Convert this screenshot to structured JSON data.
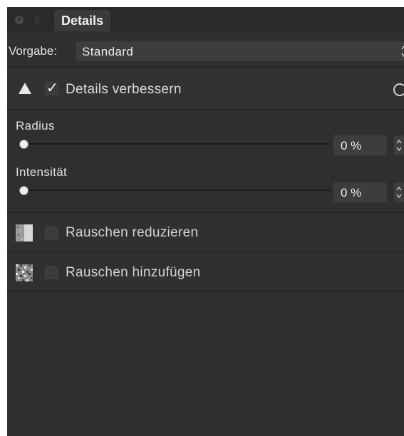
{
  "panel": {
    "tab_title": "Details",
    "close_icon": "close-icon"
  },
  "preset": {
    "label": "Vorgabe:",
    "value": "Standard"
  },
  "section": {
    "label": "Details verbessern",
    "checked": true,
    "icon": "triangle-icon",
    "reset_icon": "reset-icon"
  },
  "sliders": [
    {
      "label": "Radius",
      "value": "0 %",
      "level": 0
    },
    {
      "label": "Intensität",
      "value": "0 %",
      "level": 0
    }
  ],
  "rows": [
    {
      "label": "Rauschen reduzieren",
      "checked": false,
      "icon": "noise-reduce-icon"
    },
    {
      "label": "Rauschen hinzufügen",
      "checked": false,
      "icon": "noise-add-icon"
    }
  ],
  "colors": {
    "panel_bg": "#2f2f31",
    "field_bg": "#3d3d3f",
    "text": "#dedede"
  }
}
